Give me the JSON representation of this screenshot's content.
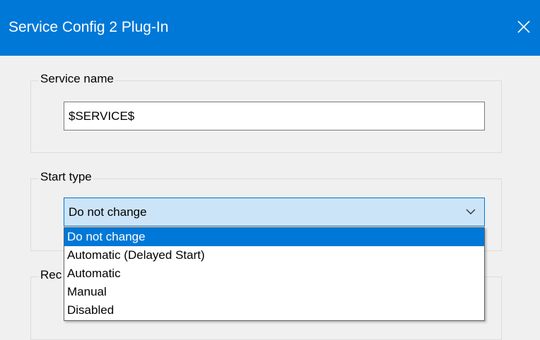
{
  "window": {
    "title": "Service Config 2 Plug-In",
    "close_icon": "close-icon"
  },
  "service_name_group": {
    "label": "Service name",
    "value": "$SERVICE$"
  },
  "start_type_group": {
    "label": "Start type",
    "selected": "Do not change",
    "options": [
      "Do not change",
      "Automatic (Delayed Start)",
      "Automatic",
      "Manual",
      "Disabled"
    ],
    "highlighted_index": 0
  },
  "partial_group": {
    "label_visible_fragment": "Rec"
  },
  "colors": {
    "title_bar": "#0078d7",
    "selection": "#0078d7",
    "combo_bg": "#cce4f7",
    "window_bg": "#f0f0f0"
  }
}
